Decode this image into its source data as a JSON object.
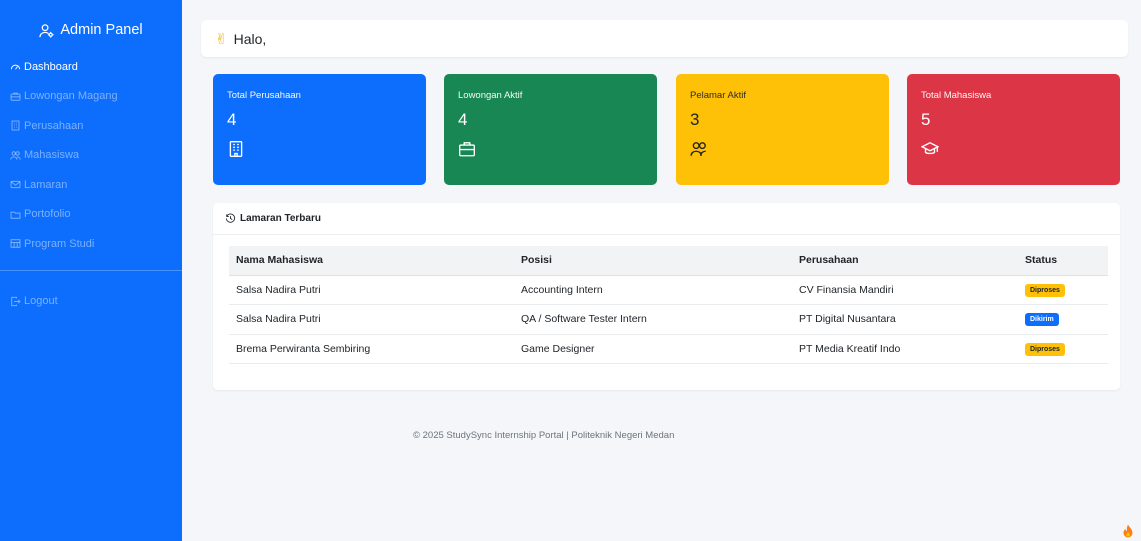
{
  "sidebar": {
    "brand": "Admin Panel",
    "items": [
      {
        "label": "Dashboard",
        "icon": "speedometer-icon"
      },
      {
        "label": "Lowongan Magang",
        "icon": "briefcase-icon"
      },
      {
        "label": "Perusahaan",
        "icon": "building-icon"
      },
      {
        "label": "Mahasiswa",
        "icon": "people-icon"
      },
      {
        "label": "Lamaran",
        "icon": "envelope-icon"
      },
      {
        "label": "Portofolio",
        "icon": "folder-icon"
      },
      {
        "label": "Program Studi",
        "icon": "grid-icon"
      }
    ],
    "logout": "Logout",
    "bg_color": "#0d6efd"
  },
  "topbar": {
    "greeting": "Halo,"
  },
  "stats": [
    {
      "label": "Total Perusahaan",
      "value": "4",
      "icon": "building-icon",
      "color": "#0d6efd"
    },
    {
      "label": "Lowongan Aktif",
      "value": "4",
      "icon": "briefcase-icon",
      "color": "#198754"
    },
    {
      "label": "Pelamar Aktif",
      "value": "3",
      "icon": "people-icon",
      "color": "#ffc107"
    },
    {
      "label": "Total Mahasiswa",
      "value": "5",
      "icon": "mortarboard-icon",
      "color": "#dc3545"
    }
  ],
  "recent": {
    "title": "Lamaran Terbaru",
    "columns": [
      "Nama Mahasiswa",
      "Posisi",
      "Perusahaan",
      "Status"
    ],
    "rows": [
      [
        "Salsa Nadira Putri",
        "Accounting Intern",
        "CV Finansia Mandiri",
        "Diproses"
      ],
      [
        "Salsa Nadira Putri",
        "QA / Software Tester Intern",
        "PT Digital Nusantara",
        "Dikirim"
      ],
      [
        "Brema Perwiranta Sembiring",
        "Game Designer",
        "PT Media Kreatif Indo",
        "Diproses"
      ]
    ]
  },
  "footer": "© 2025 StudySync Internship Portal | Politeknik Negeri Medan"
}
